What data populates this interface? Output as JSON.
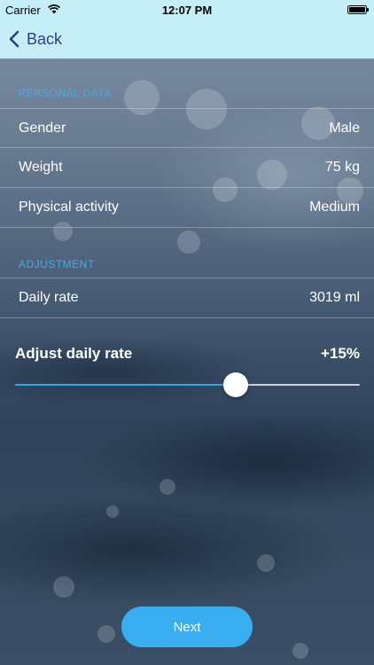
{
  "status_bar": {
    "carrier": "Carrier",
    "time": "12:07 PM",
    "icons": [
      "wifi-icon",
      "battery-icon"
    ]
  },
  "nav": {
    "back_label": "Back",
    "back_icon": "chevron-left-icon",
    "tint_color": "#2e3c84",
    "bar_color": "#c5eef7"
  },
  "personal_data": {
    "header": "PERSONAL DATA",
    "rows": [
      {
        "label": "Gender",
        "value": "Male"
      },
      {
        "label": "Weight",
        "value": "75 kg"
      },
      {
        "label": "Physical activity",
        "value": "Medium"
      }
    ]
  },
  "adjustment": {
    "header": "ADJUSTMENT",
    "rows": [
      {
        "label": "Daily rate",
        "value": "3019 ml"
      }
    ]
  },
  "adjust_daily_rate": {
    "label": "Adjust daily rate",
    "value": "+15%",
    "slider_fraction": 0.64,
    "fill_color": "#2fa7e8"
  },
  "next_button": {
    "label": "Next",
    "color": "#38adf0"
  },
  "accent_color": "#4aa8e0"
}
